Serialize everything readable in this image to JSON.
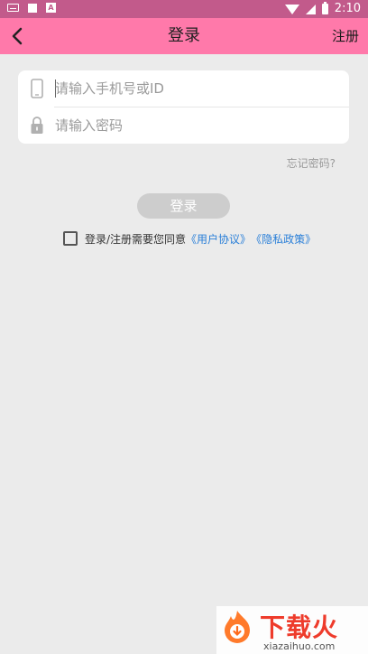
{
  "status_bar": {
    "time": "2:10",
    "left_icons": [
      "keyboard-icon",
      "square-icon",
      "a-icon"
    ],
    "right_icons": [
      "wifi-icon",
      "signal-icon",
      "battery-icon"
    ]
  },
  "top_bar": {
    "back_icon": "chevron-left-icon",
    "title": "登录",
    "register_label": "注册",
    "color": "#ff79aa"
  },
  "form": {
    "phone": {
      "icon": "phone-icon",
      "value": "",
      "placeholder": "请输入手机号或ID"
    },
    "password": {
      "icon": "lock-icon",
      "value": "",
      "placeholder": "请输入密码"
    }
  },
  "forgot_password": "忘记密码?",
  "login_button": "登录",
  "agreement": {
    "checked": false,
    "text": "登录/注册需要您同意",
    "user_agreement": "《用户协议》",
    "privacy_policy": "《隐私政策》",
    "link_color": "#2a7fd8"
  },
  "watermark": {
    "brand": "下载火",
    "url": "xiazaihuo.com"
  }
}
